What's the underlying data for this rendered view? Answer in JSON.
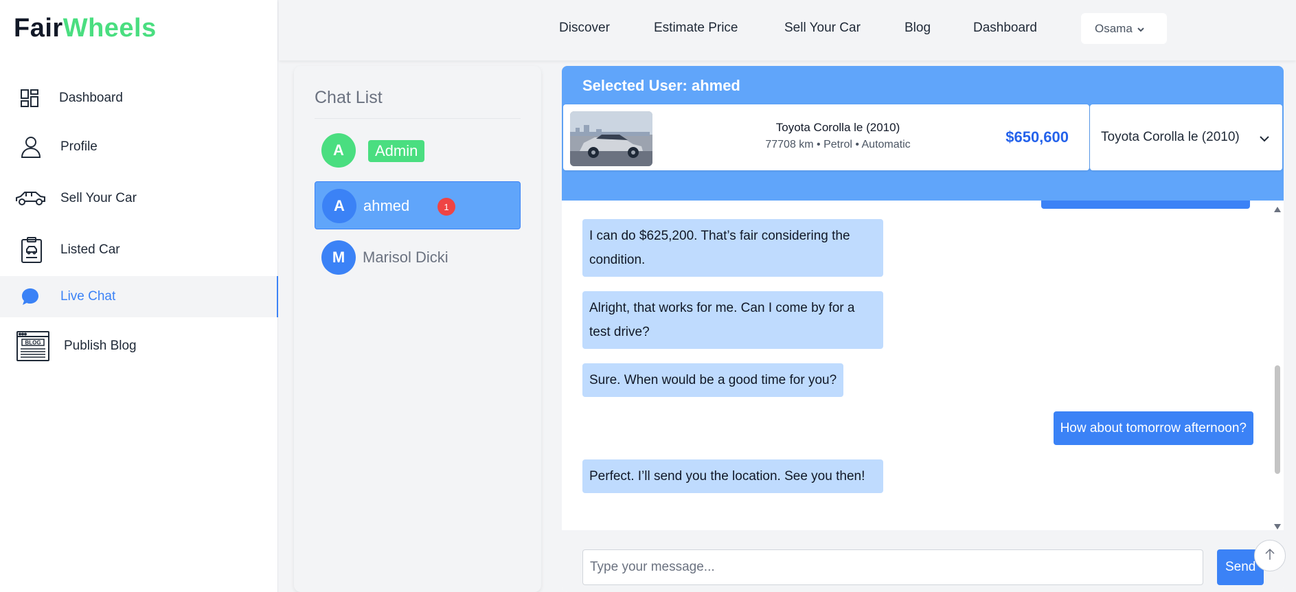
{
  "brand": {
    "part1": "Fair",
    "part2": "Wheels"
  },
  "sidebar": {
    "items": [
      {
        "label": "Dashboard",
        "icon": "dashboard-grid-icon"
      },
      {
        "label": "Profile",
        "icon": "user-icon"
      },
      {
        "label": "Sell Your Car",
        "icon": "car-icon"
      },
      {
        "label": "Listed Car",
        "icon": "clipboard-car-icon"
      },
      {
        "label": "Live Chat",
        "icon": "chat-bubble-icon",
        "active": true
      },
      {
        "label": "Publish Blog",
        "icon": "blog-icon"
      }
    ]
  },
  "topnav": {
    "links": [
      "Discover",
      "Estimate Price",
      "Sell Your Car",
      "Blog",
      "Dashboard"
    ],
    "user": "Osama"
  },
  "chatlist": {
    "title": "Chat List",
    "users": [
      {
        "initial": "A",
        "name": "Admin",
        "color": "#4ade80",
        "badge_style": "pill"
      },
      {
        "initial": "A",
        "name": "ahmed",
        "color": "#3b82f6",
        "unread": "1",
        "selected": true
      },
      {
        "initial": "M",
        "name": "Marisol Dicki",
        "color": "#3b82f6"
      }
    ]
  },
  "chat": {
    "header": "Selected User: ahmed",
    "car": {
      "name": "Toyota Corolla le (2010)",
      "meta": "77708 km • Petrol • Automatic",
      "price": "$650,600"
    },
    "car_select": "Toyota Corolla le (2010)",
    "messages": [
      {
        "dir": "in",
        "text": "I can do $625,200. That’s fair considering the condition."
      },
      {
        "dir": "in",
        "text": "Alright, that works for me. Can I come by for a test drive?"
      },
      {
        "dir": "in",
        "text": "Sure. When would be a good time for you?"
      },
      {
        "dir": "out",
        "text": "How about tomorrow afternoon?"
      },
      {
        "dir": "in",
        "text": "Perfect. I’ll send you the location. See you then!"
      }
    ],
    "input_placeholder": "Type your message...",
    "send_label": "Send"
  },
  "colors": {
    "accent": "#3b82f6",
    "brand_green": "#4ade80",
    "header_blue": "#60a5fa",
    "bubble_in": "#bfdbfe"
  }
}
